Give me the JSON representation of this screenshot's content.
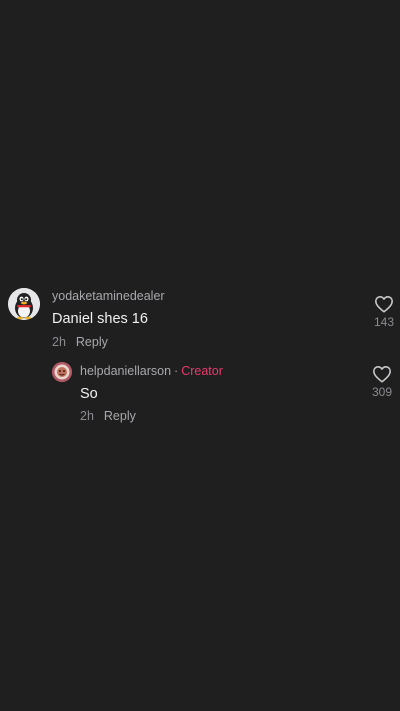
{
  "comments": [
    {
      "username": "yodaketaminedealer",
      "text": "Daniel shes 16",
      "time": "2h",
      "reply_label": "Reply",
      "likes": "143",
      "avatar": "penguin-avatar"
    }
  ],
  "replies": [
    {
      "username": "helpdaniellarson",
      "separator": "·",
      "badge": "Creator",
      "text": "So",
      "time": "2h",
      "reply_label": "Reply",
      "likes": "309",
      "avatar": "profile-avatar"
    }
  ],
  "colors": {
    "background": "#1f1f20",
    "creator_badge": "#e83a6a",
    "primary_text": "#f1f1f2",
    "secondary_text": "#a8a8ad"
  }
}
